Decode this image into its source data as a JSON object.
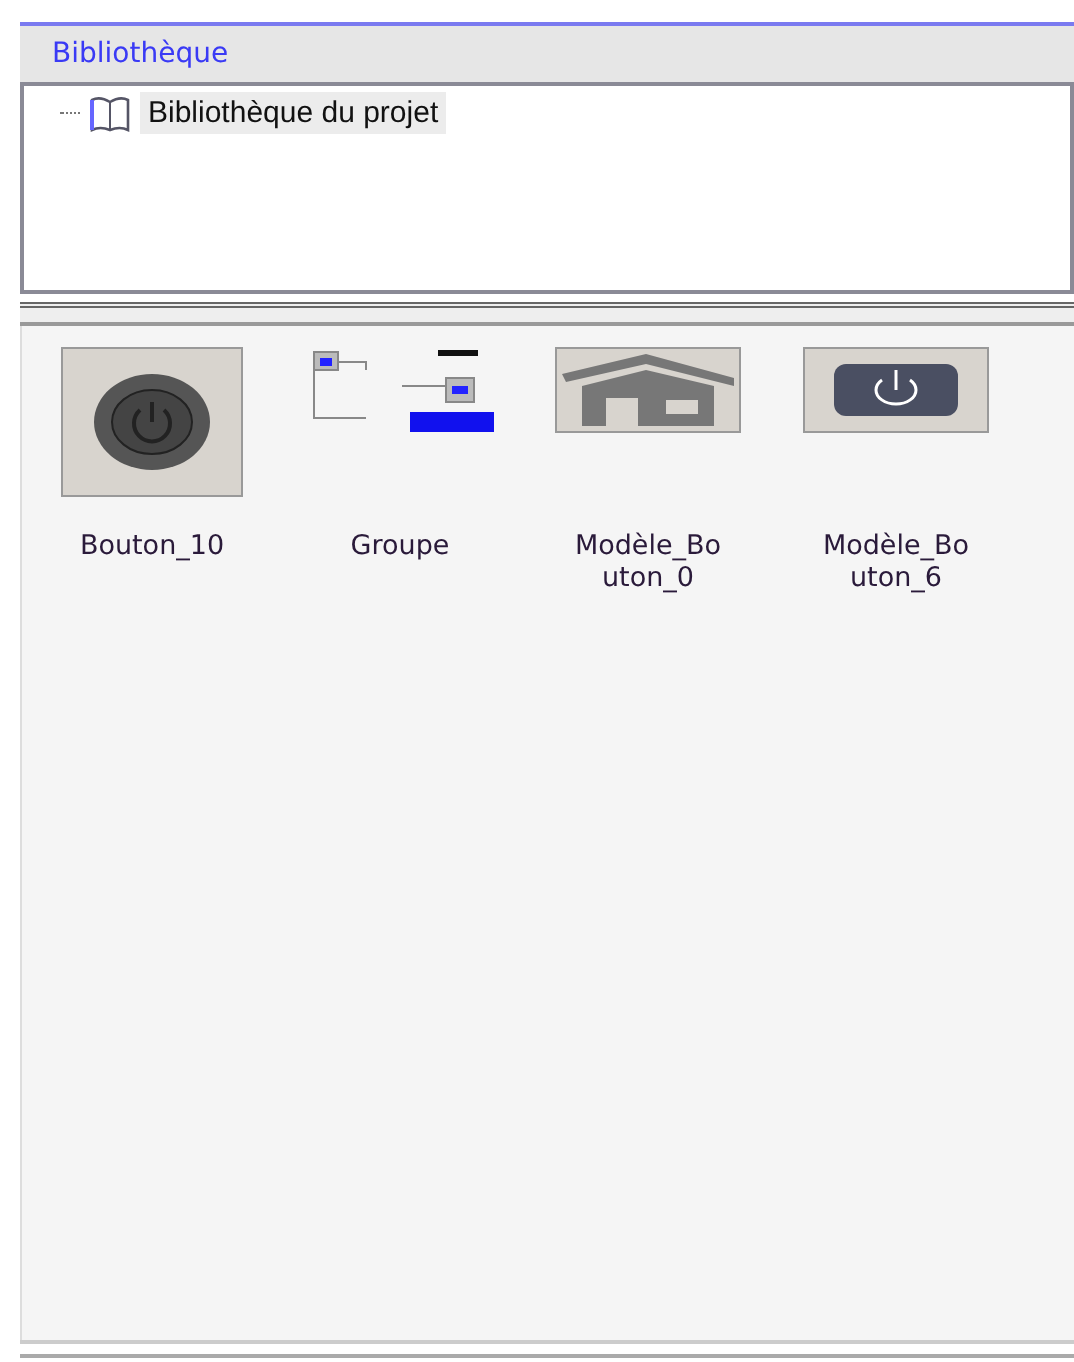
{
  "panel": {
    "title": "Bibliothèque"
  },
  "tree": [
    {
      "label": "Bibliothèque du projet",
      "selected": true
    }
  ],
  "items": [
    {
      "name": "Bouton_10",
      "kind": "round-button"
    },
    {
      "name": "Groupe",
      "kind": "diagram"
    },
    {
      "name": "Modèle_Bouton_0",
      "kind": "house"
    },
    {
      "name": "Modèle_Bouton_6",
      "kind": "power-bar"
    }
  ]
}
